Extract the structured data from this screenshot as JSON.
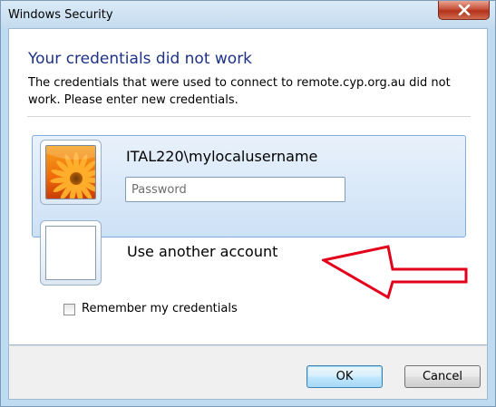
{
  "window": {
    "title": "Windows Security"
  },
  "main": {
    "heading": "Your credentials did not work",
    "message": "The credentials that were used to connect to remote.cyp.org.au did not work. Please enter new credentials."
  },
  "accounts": {
    "selected_username": "ITAL220\\mylocalusername",
    "password_placeholder": "Password",
    "password_value": "",
    "other_account_label": "Use another account"
  },
  "options": {
    "remember_label": "Remember my credentials",
    "remember_checked": false
  },
  "buttons": {
    "ok_label": "OK",
    "cancel_label": "Cancel"
  },
  "icons": {
    "close": "close-icon",
    "user_picture": "flower-user-picture",
    "annotation": "red-arrow-annotation"
  },
  "colors": {
    "heading": "#1e3287",
    "arrow": "#e2001a",
    "close_button": "#c7523b"
  }
}
